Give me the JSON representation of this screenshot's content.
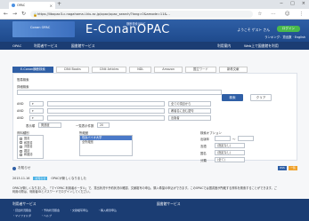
{
  "browser": {
    "tab_title": "OPAC",
    "tab_close": "×",
    "new_tab": "+",
    "window_controls": [
      "−",
      "□",
      "×"
    ],
    "url": "https://libopac3-c.nagahama.i.kiu.ac.jp/opac/opac_search/?lang=0&amode=11&...",
    "nav": [
      "←",
      "→",
      "↻"
    ],
    "tool_icons": [
      "☆",
      "⋯",
      "☺",
      "⋮"
    ]
  },
  "header": {
    "logo_sub": "Conan OPAC",
    "logo_text": "E-ConanOPAC",
    "logo_note": "横断検索OPAC",
    "welcome": "ようこそ ゲスト さん",
    "login_label": "ログイン",
    "user_line": "ランキング：貸出数 · English"
  },
  "main_nav": {
    "items": [
      "OPAC",
      "利用者サービス",
      "図書館サービス"
    ],
    "right_items": [
      "利用案内",
      "Web上で図書館を利用"
    ]
  },
  "search": {
    "tabs": [
      "E-Conan横断検索",
      "CiNii Books",
      "CiNii Articles",
      "NDL",
      "Amazon",
      "国立ワード",
      "新着文献"
    ],
    "active_tab": 0,
    "label_keyword": "簡易検索",
    "label_detail": "詳細検索",
    "field_rows": [
      {
        "label": "AND",
        "select": "全ての項目から"
      },
      {
        "label": "AND",
        "select": "著者名に含む語句"
      },
      {
        "label": "AND",
        "select": "出版者"
      }
    ],
    "right_selects": [
      "全ての項目から",
      "著者名に含む語句",
      "出版者"
    ],
    "search_button": "検索",
    "clear_button": "クリア",
    "sort_label": "表示順",
    "sort_value": "関連度",
    "perpage_label": "一覧表示件数",
    "perpage_value": "20",
    "material_label": "資料種別",
    "material_items": [
      "図書",
      "和図書",
      "洋図書",
      "雑誌",
      "和雑誌",
      "洋雑誌",
      "視聴覚"
    ],
    "location_label": "所蔵館",
    "location_items": [
      "長浜バイオ大学",
      "全所蔵館"
    ],
    "option_label": "検索オプション",
    "option_rows": [
      {
        "label": "出版年",
        "value": "〜"
      },
      {
        "label": "言語",
        "value": "(指定なし)"
      },
      {
        "label": "国名",
        "value": "(指定なし)"
      },
      {
        "label": "分類",
        "value": "(全て)"
      }
    ]
  },
  "news": {
    "title": "お知らせ",
    "btn_rss": "RSS",
    "btn_more": "一覧",
    "date": "2015.11.16",
    "badge": "お知らせ",
    "item": "OPACが新しくなりました",
    "body": "OPACが新しくなりました。「マイOPAC 利用者ポータル」で、貸出状況や予約状況の確認、文献複写の申込、購入希望の申込ができます。このOPACでは図書館が所蔵する資料を検索することができます。ご利用の際は、利用者IDとパスワードでログインしてください。"
  },
  "footer": {
    "left_heading": "利用者サービス",
    "right_heading": "図書館サービス",
    "links": [
      "・貸出状況照会",
      "・予約状況照会",
      "・文献複写申込",
      "・購入希望申込",
      "・マイフォルダ",
      "・ヘルプ"
    ]
  },
  "colors": {
    "primary": "#2f5fa6",
    "dark_nav": "#1b3d73",
    "login": "#49b94c",
    "accent": "#f0a22c"
  }
}
